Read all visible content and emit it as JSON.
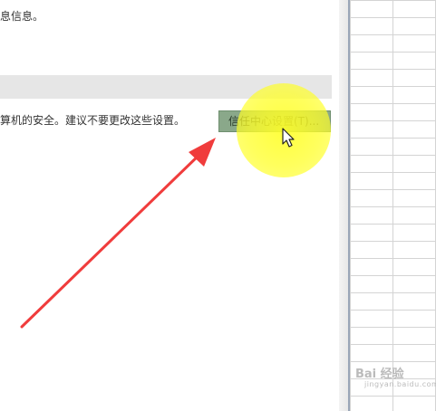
{
  "dialog": {
    "intro_text": "息信息。",
    "security_text": "算机的安全。建议不要更改这些设置。",
    "trust_center_button_label": "信任中心设置(T)..."
  },
  "watermark": {
    "brand": "Bai 经验",
    "sub": "jingyan.baidu.com"
  },
  "colors": {
    "highlight": "#ffff28",
    "arrow": "#f03c3c",
    "button_bg": "#8aa88a"
  }
}
